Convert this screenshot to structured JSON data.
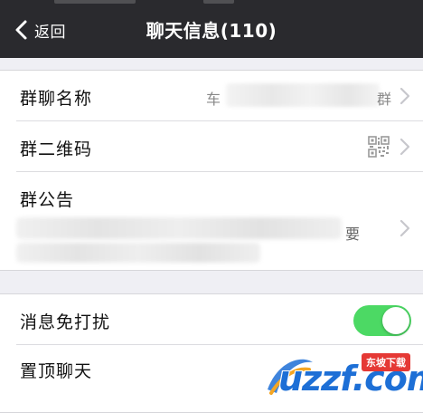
{
  "nav": {
    "back_label": "返回",
    "title": "聊天信息(110)"
  },
  "settings": {
    "group_name": {
      "label": "群聊名称",
      "value_start": "车",
      "value_end": "群"
    },
    "group_qr": {
      "label": "群二维码"
    },
    "group_notice": {
      "label": "群公告",
      "preview_tail": "要"
    },
    "mute": {
      "label": "消息免打扰",
      "enabled": true
    },
    "pin_chat": {
      "label": "置顶聊天"
    }
  },
  "watermark": {
    "brand": "uzzf.com",
    "badge": "东坡下载"
  },
  "colors": {
    "nav_background": "#2a2a2e",
    "page_background": "#efeff4",
    "toggle_on": "#4cd964"
  },
  "icons": [
    "back-chevron-icon",
    "chevron-right-icon",
    "qr-code-icon"
  ]
}
